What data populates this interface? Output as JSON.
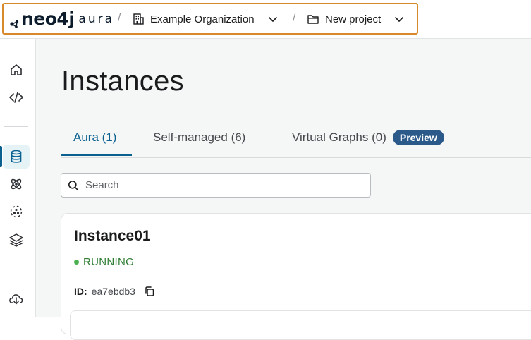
{
  "header": {
    "logo": {
      "wordmark": "neo4j",
      "product": "aura"
    },
    "separator": "/",
    "organization": {
      "label": "Example Organization",
      "icon": "building-icon"
    },
    "project": {
      "label": "New project",
      "icon": "folder-icon"
    }
  },
  "sidebar": {
    "items": [
      {
        "name": "home",
        "icon": "home-icon"
      },
      {
        "name": "developer",
        "icon": "code-icon"
      },
      {
        "name": "instances",
        "icon": "database-icon",
        "active": true
      },
      {
        "name": "graph-analytics",
        "icon": "atom-icon"
      },
      {
        "name": "data-import",
        "icon": "graph-icon"
      },
      {
        "name": "layers",
        "icon": "layers-icon"
      },
      {
        "name": "download",
        "icon": "cloud-download-icon"
      }
    ]
  },
  "main": {
    "title": "Instances",
    "tabs": [
      {
        "label": "Aura (1)",
        "active": true
      },
      {
        "label": "Self-managed (6)",
        "active": false
      },
      {
        "label": "Virtual Graphs (0)",
        "active": false,
        "badge": "Preview"
      }
    ],
    "search": {
      "placeholder": "Search",
      "value": ""
    },
    "instances": [
      {
        "name": "Instance01",
        "status": "RUNNING",
        "id_label": "ID:",
        "id": "ea7ebdb3"
      }
    ]
  },
  "colors": {
    "accent": "#0a6190",
    "highlight_border": "#d88a2b",
    "running": "#2e7d32",
    "badge_bg": "#2b5a8a",
    "main_bg": "#f5f6f6"
  }
}
